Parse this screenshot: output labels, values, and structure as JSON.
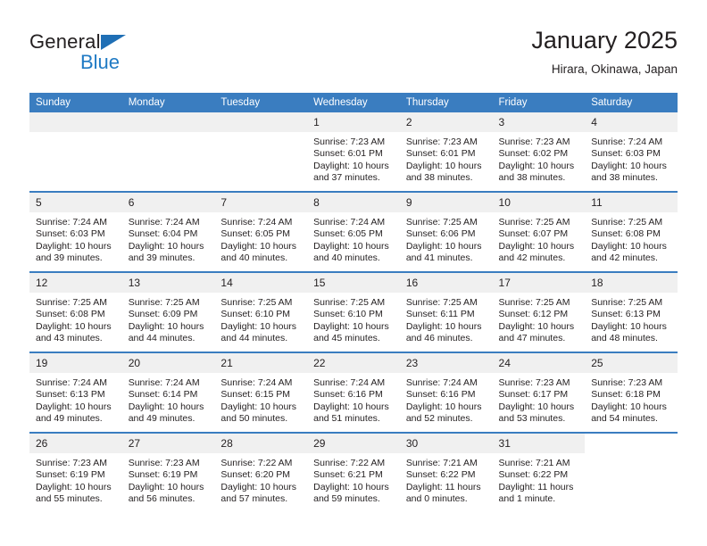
{
  "brand": {
    "name_top": "General",
    "name_bottom": "Blue",
    "accent_color": "#1f7ac4",
    "triangle_color": "#1f6fb5"
  },
  "header": {
    "title": "January 2025",
    "subtitle": "Hirara, Okinawa, Japan"
  },
  "theme": {
    "header_row_bg": "#3a7dc0",
    "header_row_text": "#ffffff",
    "daynum_bg": "#f0f0f0",
    "row_divider": "#3a7dc0",
    "body_text": "#231f20"
  },
  "weekdays": [
    "Sunday",
    "Monday",
    "Tuesday",
    "Wednesday",
    "Thursday",
    "Friday",
    "Saturday"
  ],
  "weeks": [
    [
      {
        "day": "",
        "empty": true,
        "blank": false,
        "sunrise": "",
        "sunset": "",
        "daylight1": "",
        "daylight2": ""
      },
      {
        "day": "",
        "empty": true,
        "blank": false,
        "sunrise": "",
        "sunset": "",
        "daylight1": "",
        "daylight2": ""
      },
      {
        "day": "",
        "empty": true,
        "blank": false,
        "sunrise": "",
        "sunset": "",
        "daylight1": "",
        "daylight2": ""
      },
      {
        "day": "1",
        "sunrise": "Sunrise: 7:23 AM",
        "sunset": "Sunset: 6:01 PM",
        "daylight1": "Daylight: 10 hours",
        "daylight2": "and 37 minutes."
      },
      {
        "day": "2",
        "sunrise": "Sunrise: 7:23 AM",
        "sunset": "Sunset: 6:01 PM",
        "daylight1": "Daylight: 10 hours",
        "daylight2": "and 38 minutes."
      },
      {
        "day": "3",
        "sunrise": "Sunrise: 7:23 AM",
        "sunset": "Sunset: 6:02 PM",
        "daylight1": "Daylight: 10 hours",
        "daylight2": "and 38 minutes."
      },
      {
        "day": "4",
        "sunrise": "Sunrise: 7:24 AM",
        "sunset": "Sunset: 6:03 PM",
        "daylight1": "Daylight: 10 hours",
        "daylight2": "and 38 minutes."
      }
    ],
    [
      {
        "day": "5",
        "sunrise": "Sunrise: 7:24 AM",
        "sunset": "Sunset: 6:03 PM",
        "daylight1": "Daylight: 10 hours",
        "daylight2": "and 39 minutes."
      },
      {
        "day": "6",
        "sunrise": "Sunrise: 7:24 AM",
        "sunset": "Sunset: 6:04 PM",
        "daylight1": "Daylight: 10 hours",
        "daylight2": "and 39 minutes."
      },
      {
        "day": "7",
        "sunrise": "Sunrise: 7:24 AM",
        "sunset": "Sunset: 6:05 PM",
        "daylight1": "Daylight: 10 hours",
        "daylight2": "and 40 minutes."
      },
      {
        "day": "8",
        "sunrise": "Sunrise: 7:24 AM",
        "sunset": "Sunset: 6:05 PM",
        "daylight1": "Daylight: 10 hours",
        "daylight2": "and 40 minutes."
      },
      {
        "day": "9",
        "sunrise": "Sunrise: 7:25 AM",
        "sunset": "Sunset: 6:06 PM",
        "daylight1": "Daylight: 10 hours",
        "daylight2": "and 41 minutes."
      },
      {
        "day": "10",
        "sunrise": "Sunrise: 7:25 AM",
        "sunset": "Sunset: 6:07 PM",
        "daylight1": "Daylight: 10 hours",
        "daylight2": "and 42 minutes."
      },
      {
        "day": "11",
        "sunrise": "Sunrise: 7:25 AM",
        "sunset": "Sunset: 6:08 PM",
        "daylight1": "Daylight: 10 hours",
        "daylight2": "and 42 minutes."
      }
    ],
    [
      {
        "day": "12",
        "sunrise": "Sunrise: 7:25 AM",
        "sunset": "Sunset: 6:08 PM",
        "daylight1": "Daylight: 10 hours",
        "daylight2": "and 43 minutes."
      },
      {
        "day": "13",
        "sunrise": "Sunrise: 7:25 AM",
        "sunset": "Sunset: 6:09 PM",
        "daylight1": "Daylight: 10 hours",
        "daylight2": "and 44 minutes."
      },
      {
        "day": "14",
        "sunrise": "Sunrise: 7:25 AM",
        "sunset": "Sunset: 6:10 PM",
        "daylight1": "Daylight: 10 hours",
        "daylight2": "and 44 minutes."
      },
      {
        "day": "15",
        "sunrise": "Sunrise: 7:25 AM",
        "sunset": "Sunset: 6:10 PM",
        "daylight1": "Daylight: 10 hours",
        "daylight2": "and 45 minutes."
      },
      {
        "day": "16",
        "sunrise": "Sunrise: 7:25 AM",
        "sunset": "Sunset: 6:11 PM",
        "daylight1": "Daylight: 10 hours",
        "daylight2": "and 46 minutes."
      },
      {
        "day": "17",
        "sunrise": "Sunrise: 7:25 AM",
        "sunset": "Sunset: 6:12 PM",
        "daylight1": "Daylight: 10 hours",
        "daylight2": "and 47 minutes."
      },
      {
        "day": "18",
        "sunrise": "Sunrise: 7:25 AM",
        "sunset": "Sunset: 6:13 PM",
        "daylight1": "Daylight: 10 hours",
        "daylight2": "and 48 minutes."
      }
    ],
    [
      {
        "day": "19",
        "sunrise": "Sunrise: 7:24 AM",
        "sunset": "Sunset: 6:13 PM",
        "daylight1": "Daylight: 10 hours",
        "daylight2": "and 49 minutes."
      },
      {
        "day": "20",
        "sunrise": "Sunrise: 7:24 AM",
        "sunset": "Sunset: 6:14 PM",
        "daylight1": "Daylight: 10 hours",
        "daylight2": "and 49 minutes."
      },
      {
        "day": "21",
        "sunrise": "Sunrise: 7:24 AM",
        "sunset": "Sunset: 6:15 PM",
        "daylight1": "Daylight: 10 hours",
        "daylight2": "and 50 minutes."
      },
      {
        "day": "22",
        "sunrise": "Sunrise: 7:24 AM",
        "sunset": "Sunset: 6:16 PM",
        "daylight1": "Daylight: 10 hours",
        "daylight2": "and 51 minutes."
      },
      {
        "day": "23",
        "sunrise": "Sunrise: 7:24 AM",
        "sunset": "Sunset: 6:16 PM",
        "daylight1": "Daylight: 10 hours",
        "daylight2": "and 52 minutes."
      },
      {
        "day": "24",
        "sunrise": "Sunrise: 7:23 AM",
        "sunset": "Sunset: 6:17 PM",
        "daylight1": "Daylight: 10 hours",
        "daylight2": "and 53 minutes."
      },
      {
        "day": "25",
        "sunrise": "Sunrise: 7:23 AM",
        "sunset": "Sunset: 6:18 PM",
        "daylight1": "Daylight: 10 hours",
        "daylight2": "and 54 minutes."
      }
    ],
    [
      {
        "day": "26",
        "sunrise": "Sunrise: 7:23 AM",
        "sunset": "Sunset: 6:19 PM",
        "daylight1": "Daylight: 10 hours",
        "daylight2": "and 55 minutes."
      },
      {
        "day": "27",
        "sunrise": "Sunrise: 7:23 AM",
        "sunset": "Sunset: 6:19 PM",
        "daylight1": "Daylight: 10 hours",
        "daylight2": "and 56 minutes."
      },
      {
        "day": "28",
        "sunrise": "Sunrise: 7:22 AM",
        "sunset": "Sunset: 6:20 PM",
        "daylight1": "Daylight: 10 hours",
        "daylight2": "and 57 minutes."
      },
      {
        "day": "29",
        "sunrise": "Sunrise: 7:22 AM",
        "sunset": "Sunset: 6:21 PM",
        "daylight1": "Daylight: 10 hours",
        "daylight2": "and 59 minutes."
      },
      {
        "day": "30",
        "sunrise": "Sunrise: 7:21 AM",
        "sunset": "Sunset: 6:22 PM",
        "daylight1": "Daylight: 11 hours",
        "daylight2": "and 0 minutes."
      },
      {
        "day": "31",
        "sunrise": "Sunrise: 7:21 AM",
        "sunset": "Sunset: 6:22 PM",
        "daylight1": "Daylight: 11 hours",
        "daylight2": "and 1 minute."
      },
      {
        "day": "",
        "empty": true,
        "blank": true,
        "sunrise": "",
        "sunset": "",
        "daylight1": "",
        "daylight2": ""
      }
    ]
  ]
}
